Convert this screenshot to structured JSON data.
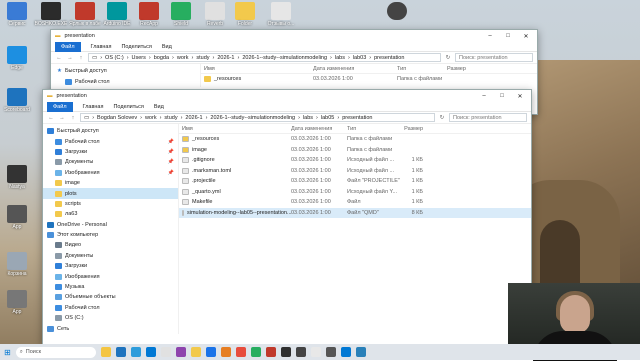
{
  "desktop": {
    "icons": [
      {
        "label": "Сервис",
        "color": "#3a7bd5"
      },
      {
        "label": "BOSHKO.EXE",
        "color": "#2b2b2b"
      },
      {
        "label": "Ярлык в лабе",
        "color": "#c0392b"
      },
      {
        "label": "Arduino IDE",
        "color": "#00979d"
      },
      {
        "label": "RecApp",
        "color": "#c0392b"
      },
      {
        "label": "Shield",
        "color": "#27ae60"
      },
      {
        "label": "Reverb",
        "color": "#e0e0e0"
      },
      {
        "label": "Folder",
        "color": "#f2c94c"
      },
      {
        "label": "Отзывы о...",
        "color": "#e6e6e6"
      },
      {
        "label": "Edge",
        "color": "#1d8fe1"
      },
      {
        "label": "Scoreboard",
        "color": "#1e73be"
      },
      {
        "label": "Корзина",
        "color": "#9aa7b4"
      },
      {
        "label": "Nastya",
        "color": "#333"
      },
      {
        "label": "App",
        "color": "#555"
      },
      {
        "label": "App",
        "color": "#777"
      }
    ]
  },
  "back_window": {
    "title": "presentation",
    "ribbon": [
      "Файл",
      "Главная",
      "Поделиться",
      "Вид"
    ],
    "path": [
      "OS (C:)",
      "Users",
      "bogda",
      "work",
      "study",
      "2026-1",
      "2026-1--study--simulationmodeling",
      "labs",
      "lab03",
      "presentation"
    ],
    "search_placeholder": "Поиск: presentation",
    "quick_access": "Быстрый доступ",
    "desktop_item": "Рабочий стол",
    "columns": {
      "name": "Имя",
      "date": "Дата изменения",
      "type": "Тип",
      "size": "Размер"
    },
    "first_row": {
      "name": "_resources",
      "date": "03.03.2026 1:00",
      "type": "Папка с файлами"
    }
  },
  "front_window": {
    "title": "presentation",
    "ribbon": [
      "Файл",
      "Главная",
      "Поделиться",
      "Вид"
    ],
    "path": [
      "Bogdan Solovev",
      "work",
      "study",
      "2026-1",
      "2026-1--study--simulationmodeling",
      "labs",
      "lab05",
      "presentation"
    ],
    "search_placeholder": "Поиск: presentation",
    "sidebar": [
      {
        "label": "Быстрый доступ",
        "color": "#2f7fd8",
        "indent": 4,
        "pinned": false
      },
      {
        "label": "Рабочий стол",
        "color": "#3d8de0",
        "indent": 12,
        "pinned": true
      },
      {
        "label": "Загрузки",
        "color": "#2f7fd8",
        "indent": 12,
        "pinned": true
      },
      {
        "label": "Документы",
        "color": "#8a9aa8",
        "indent": 12,
        "pinned": true
      },
      {
        "label": "Изображения",
        "color": "#6bb3e8",
        "indent": 12,
        "pinned": true
      },
      {
        "label": "image",
        "color": "#f2c94c",
        "indent": 12,
        "pinned": false
      },
      {
        "label": "plots",
        "color": "#f2c94c",
        "indent": 12,
        "pinned": false,
        "selected": true
      },
      {
        "label": "scripts",
        "color": "#f2c94c",
        "indent": 12,
        "pinned": false
      },
      {
        "label": "ла63",
        "color": "#f2c94c",
        "indent": 12,
        "pinned": false
      },
      {
        "label": "OneDrive - Personal",
        "color": "#1e73be",
        "indent": 4,
        "pinned": false
      },
      {
        "label": "Этот компьютер",
        "color": "#4a90d9",
        "indent": 4,
        "pinned": false
      },
      {
        "label": "Видео",
        "color": "#6a7b8c",
        "indent": 12,
        "pinned": false
      },
      {
        "label": "Документы",
        "color": "#8a9aa8",
        "indent": 12,
        "pinned": false
      },
      {
        "label": "Загрузки",
        "color": "#2f7fd8",
        "indent": 12,
        "pinned": false
      },
      {
        "label": "Изображения",
        "color": "#6bb3e8",
        "indent": 12,
        "pinned": false
      },
      {
        "label": "Музыка",
        "color": "#3d8de0",
        "indent": 12,
        "pinned": false
      },
      {
        "label": "Объемные объекты",
        "color": "#5aa0e0",
        "indent": 12,
        "pinned": false
      },
      {
        "label": "Рабочий стол",
        "color": "#3d8de0",
        "indent": 12,
        "pinned": false
      },
      {
        "label": "OS (C:)",
        "color": "#8a9aa8",
        "indent": 12,
        "pinned": false
      },
      {
        "label": "Сеть",
        "color": "#4a90d9",
        "indent": 4,
        "pinned": false
      }
    ],
    "columns": {
      "name": "Имя",
      "date": "Дата изменения",
      "type": "Тип",
      "size": "Размер"
    },
    "files": [
      {
        "name": "_resources",
        "date": "03.03.2026 1:00",
        "type": "Папка с файлами",
        "size": "",
        "color": "#f2c94c"
      },
      {
        "name": "image",
        "date": "03.03.2026 1:00",
        "type": "Папка с файлами",
        "size": "",
        "color": "#f2c94c"
      },
      {
        "name": ".gitignore",
        "date": "03.03.2026 1:00",
        "type": "Исходный файл ...",
        "size": "1 КБ",
        "color": "#e8e8e8"
      },
      {
        "name": ".marksman.toml",
        "date": "03.03.2026 1:00",
        "type": "Исходный файл ...",
        "size": "1 КБ",
        "color": "#e8e8e8"
      },
      {
        "name": ".projectile",
        "date": "03.03.2026 1:00",
        "type": "Файл \"PROJECTILE\"",
        "size": "1 КБ",
        "color": "#e8e8e8"
      },
      {
        "name": "_quarto.yml",
        "date": "03.03.2026 1:00",
        "type": "Исходный файл Y...",
        "size": "1 КБ",
        "color": "#e8e8e8"
      },
      {
        "name": "Makefile",
        "date": "03.03.2026 1:00",
        "type": "Файл",
        "size": "1 КБ",
        "color": "#e8e8e8"
      },
      {
        "name": "simulation-modeling--lab05--presentation...",
        "date": "03.03.2026 1:00",
        "type": "Файл \"QMD\"",
        "size": "8 КБ",
        "color": "#e8e8e8",
        "selected": true
      }
    ]
  },
  "taskbar": {
    "search": "Поиск",
    "apps": [
      "#f4c542",
      "#1e73be",
      "#2d9cdb",
      "#0078d4",
      "#e1e1e1",
      "#8e44ad",
      "#f2c94c",
      "#1a73e8",
      "#e67e22",
      "#e74c3c",
      "#27ae60",
      "#c0392b",
      "#2f2f2f",
      "#444",
      "#e8e8e8",
      "#555",
      "#0078d4",
      "#2980b9"
    ]
  }
}
